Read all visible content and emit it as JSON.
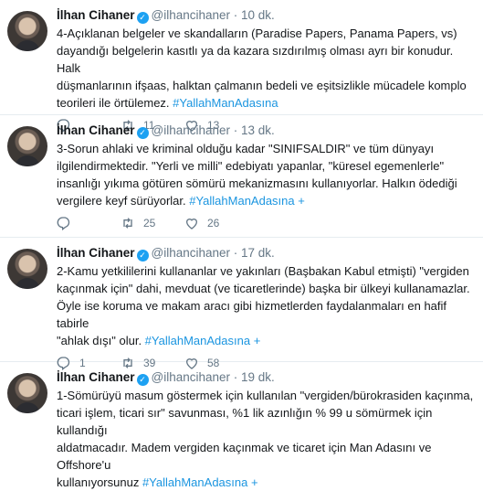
{
  "tweets": [
    {
      "name": "İlhan Cihaner",
      "handle": "@ilhancihaner",
      "time": "10 dk.",
      "text": "4-Açıklanan belgeler ve skandalların (Paradise Papers, Panama Papers, vs)\ndayandığı belgelerin kasıtlı ya da kazara sızdırılmış olması ayrı bir konudur. Halk\ndüşmanlarının ifşaas, halktan çalmanın bedeli ve eşitsizlikle mücadele komplo\nteorileri ile örtülemez. ",
      "hashtag": "#YallahManAdasına",
      "more": "",
      "reply_count": "",
      "retweet_count": "11",
      "like_count": "13"
    },
    {
      "name": "İlhan Cihaner",
      "handle": "@ilhancihaner",
      "time": "13 dk.",
      "text": "3-Sorun ahlaki ve kriminal olduğu kadar \"SINIFSALDIR\" ve tüm dünyayı\nilgilendirmektedir. \"Yerli ve milli\" edebiyatı yapanlar, \"küresel egemenlerle\"\ninsanlığı yıkıma götüren sömürü mekanizmasını kullanıyorlar. Halkın ödediği\nvergilere keyf sürüyorlar. ",
      "hashtag": "#YallahManAdasına",
      "more": " +",
      "reply_count": "",
      "retweet_count": "25",
      "like_count": "26"
    },
    {
      "name": "İlhan Cihaner",
      "handle": "@ilhancihaner",
      "time": "17 dk.",
      "text": "2-Kamu yetkililerini kullananlar ve yakınları (Başbakan Kabul etmişti) \"vergiden\nkaçınmak için\" dahi, mevduat (ve ticaretlerinde) başka bir ülkeyi kullanamazlar.\nÖyle ise koruma ve makam aracı gibi hizmetlerden faydalanmaları en hafif tabirle\n\"ahlak dışı\" olur. ",
      "hashtag": "#YallahManAdasına",
      "more": " +",
      "reply_count": "1",
      "retweet_count": "39",
      "like_count": "58"
    },
    {
      "name": "İlhan Cihaner",
      "handle": "@ilhancihaner",
      "time": "19 dk.",
      "text": "1-Sömürüyü masum göstermek için kullanılan \"vergiden/bürokrasiden kaçınma,\nticari işlem, ticari sır\" savunması, %1 lik azınlığın % 99 u sömürmek için kullandığı\naldatmacadır. Madem vergiden kaçınmak ve ticaret için Man Adasını ve Offshore'u\nkullanıyorsunuz ",
      "hashtag": "#YallahManAdasına",
      "more": " +",
      "reply_count": "",
      "retweet_count": "",
      "like_count": ""
    }
  ],
  "icons": {
    "verified": "verified-badge-icon",
    "reply": "reply-icon",
    "retweet": "retweet-icon",
    "like": "like-icon"
  },
  "colors": {
    "accent": "#1b95e0",
    "verified": "#1da1f2",
    "muted": "#657786",
    "divider": "#e6ecf0"
  }
}
